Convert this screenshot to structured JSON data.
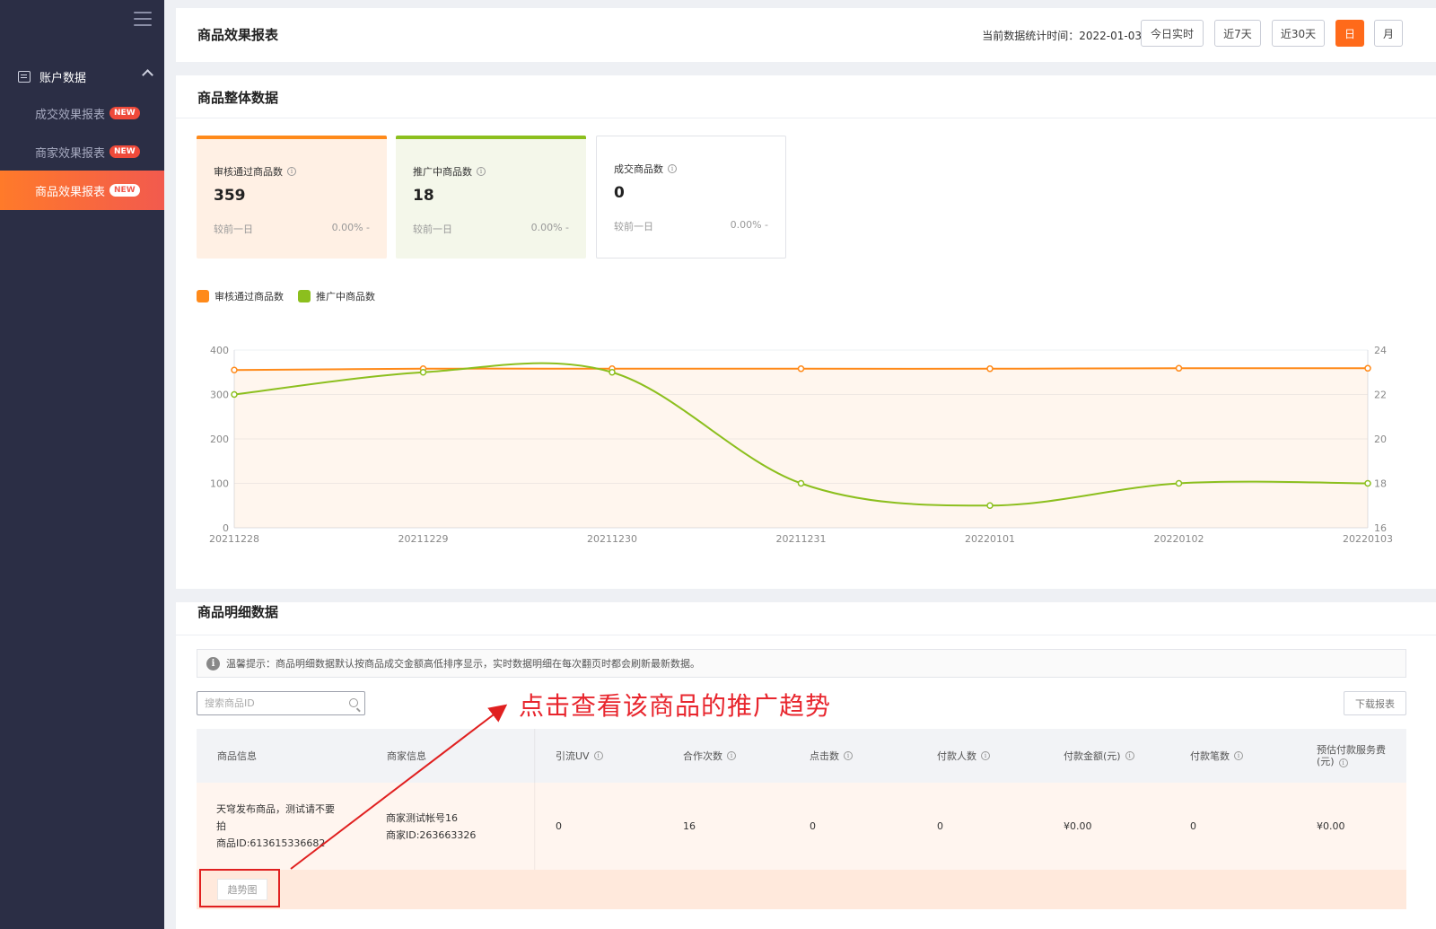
{
  "sidebar": {
    "group_label": "账户数据",
    "items": [
      {
        "label": "成交效果报表",
        "badge": "NEW",
        "active": false
      },
      {
        "label": "商家效果报表",
        "badge": "NEW",
        "active": false
      },
      {
        "label": "商品效果报表",
        "badge": "NEW",
        "active": true
      }
    ]
  },
  "header": {
    "title": "商品效果报表",
    "stat_time": "当前数据统计时间：2022-01-03",
    "buttons": {
      "today": "今日实时",
      "d7": "近7天",
      "d30": "近30天",
      "day": "日",
      "month": "月"
    }
  },
  "overview": {
    "title": "商品整体数据",
    "cards": [
      {
        "label": "审核通过商品数",
        "value": "359",
        "compare": "较前一日",
        "pct": "0.00% -"
      },
      {
        "label": "推广中商品数",
        "value": "18",
        "compare": "较前一日",
        "pct": "0.00% -"
      },
      {
        "label": "成交商品数",
        "value": "0",
        "compare": "较前一日",
        "pct": "0.00% -"
      }
    ],
    "legend": [
      {
        "name": "审核通过商品数",
        "color": "#ff8a1a"
      },
      {
        "name": "推广中商品数",
        "color": "#8cbf1e"
      }
    ]
  },
  "chart_data": {
    "type": "line",
    "x": [
      "20211228",
      "20211229",
      "20211230",
      "20211231",
      "20220101",
      "20220102",
      "20220103"
    ],
    "series": [
      {
        "name": "审核通过商品数",
        "axis": "left",
        "color": "#ff8a1a",
        "values": [
          355,
          358,
          358,
          358,
          358,
          359,
          359
        ]
      },
      {
        "name": "推广中商品数",
        "axis": "right",
        "color": "#8cbf1e",
        "values": [
          22,
          23,
          23,
          18,
          17,
          18,
          18
        ]
      }
    ],
    "y_left": {
      "ylim": [
        0,
        400
      ],
      "ticks": [
        "0",
        "100",
        "200",
        "300",
        "400"
      ]
    },
    "y_right": {
      "ylim": [
        16,
        24
      ],
      "ticks": [
        "16",
        "18",
        "20",
        "22",
        "24"
      ]
    },
    "area_fill": true,
    "grid": true
  },
  "detail": {
    "title": "商品明细数据",
    "tip": "温馨提示：商品明细数据默认按商品成交金额高低排序显示，实时数据明细在每次翻页时都会刷新最新数据。",
    "search_placeholder": "搜索商品ID",
    "download": "下载报表",
    "columns": [
      "商品信息",
      "商家信息",
      "引流UV",
      "合作次数",
      "点击数",
      "付款人数",
      "付款金额(元)",
      "付款笔数",
      "预估付款服务费",
      "(元)"
    ],
    "row": {
      "product_line1": "天穹发布商品，测试请不要",
      "product_line2": "拍",
      "product_id": "商品ID:613615336682",
      "merchant_name": "商家测试帐号16",
      "merchant_id": "商家ID:263663326",
      "uv": "0",
      "coop": "16",
      "clicks": "0",
      "payers": "0",
      "amount": "¥0.00",
      "orders": "0",
      "fee": "¥0.00"
    },
    "trend_button": "趋势图"
  },
  "annotation": "点击查看该商品的推广趋势"
}
